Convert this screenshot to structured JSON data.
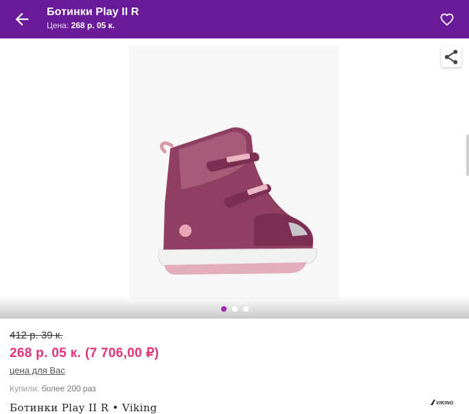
{
  "header": {
    "title": "Ботинки Play II R",
    "price_label": "Цена:",
    "price_value": "268 р. 05 к."
  },
  "gallery": {
    "dots": [
      "active",
      "inactive",
      "inactive"
    ]
  },
  "product": {
    "old_price": "412 р. 39 к.",
    "price": "268 р. 05 к.",
    "price_rub": "(7 706,00 ₽)",
    "for_you_link": "цена для Вас",
    "bought_label": "Купили:",
    "bought_value": "более 200 раз",
    "name": "Ботинки Play II R • Viking",
    "brand_logo_text": "VIKING"
  },
  "colors": {
    "header_bg": "#6a1b9a",
    "price": "#e5307a",
    "dot_active": "#9c27b0"
  },
  "icons": {
    "back": "arrow-left-icon",
    "favorite": "heart-outline-icon",
    "share": "share-icon"
  }
}
